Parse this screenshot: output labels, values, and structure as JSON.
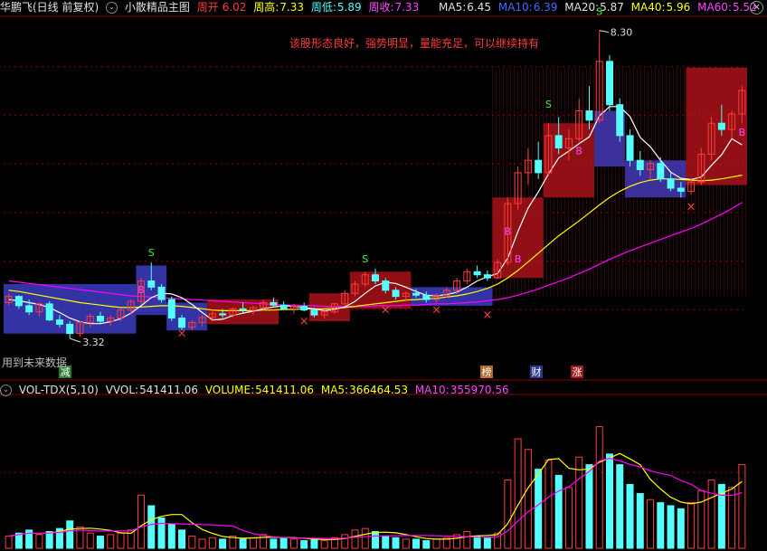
{
  "header": {
    "stock_name": "华鹏飞(日线 前复权)",
    "formula": "小散精品主图",
    "week_open_label": "周开",
    "week_open": "6.02",
    "week_high_label": "周高:",
    "week_high": "7.33",
    "week_low_label": "周低:",
    "week_low": "5.89",
    "week_close_label": "周收:",
    "week_close": "7.33",
    "ma5_label": "MA5:",
    "ma5": "6.45",
    "ma10_label": "MA10:",
    "ma10": "6.39",
    "ma20_label": "MA20:",
    "ma20": "5.87",
    "ma40_label": "MA40:",
    "ma40": "5.96",
    "ma60_label": "MA60:",
    "ma60": "5.52"
  },
  "annotation": "该股形态良好，强势明显，量能充足，可以继续持有",
  "high_label": "8.30",
  "low_label": "3.32",
  "future_note": "用到未来数据",
  "markers": {
    "jian": "减",
    "bang": "榜",
    "cai": "财",
    "zhang": "涨",
    "buy": "B",
    "sell": "S",
    "cross": "×"
  },
  "vol_header": {
    "indicator": "VOL-TDX(5,10)",
    "vvol_label": "VVOL:",
    "vvol": "541411.06",
    "volume_label": "VOLUME:",
    "volume": "541411.06",
    "ma5_label": "MA5:",
    "ma5": "366464.53",
    "ma10_label": "MA10:",
    "ma10": "355970.56"
  },
  "colors": {
    "up": "#ff3c3c",
    "down": "#54ffff",
    "ma5": "#ffffff",
    "ma10": "#ffff00",
    "ma20": "#ff00ff",
    "ma_blue": "#4040ff",
    "box_up": "#c0141c",
    "box_down": "#4444dd",
    "annotation": "#ff3c3c",
    "label_ma5": "#e0e0e0",
    "label_ma10": "#3c6cff",
    "label_ma20": "#e0e0e0",
    "label_ma40": "#ffff00",
    "label_ma60": "#ff44ff"
  },
  "chart_data": {
    "type": "candlestick",
    "y_price_range": [
      3.0,
      8.5
    ],
    "candles": [
      [
        3.9,
        4.05,
        3.85,
        4.0
      ],
      [
        4.0,
        4.02,
        3.8,
        3.85
      ],
      [
        3.85,
        3.95,
        3.7,
        3.75
      ],
      [
        3.75,
        3.9,
        3.68,
        3.88
      ],
      [
        3.88,
        3.92,
        3.6,
        3.62
      ],
      [
        3.62,
        3.7,
        3.5,
        3.55
      ],
      [
        3.55,
        3.6,
        3.32,
        3.4
      ],
      [
        3.4,
        3.6,
        3.35,
        3.58
      ],
      [
        3.58,
        3.72,
        3.5,
        3.68
      ],
      [
        3.68,
        3.75,
        3.55,
        3.6
      ],
      [
        3.6,
        3.7,
        3.52,
        3.65
      ],
      [
        3.65,
        3.8,
        3.6,
        3.78
      ],
      [
        3.78,
        3.95,
        3.7,
        3.92
      ],
      [
        3.92,
        4.3,
        3.88,
        4.25
      ],
      [
        4.25,
        4.55,
        4.1,
        4.15
      ],
      [
        4.15,
        4.2,
        3.9,
        3.95
      ],
      [
        3.95,
        4.0,
        3.6,
        3.65
      ],
      [
        3.65,
        3.7,
        3.45,
        3.5
      ],
      [
        3.5,
        3.62,
        3.45,
        3.58
      ],
      [
        3.58,
        3.7,
        3.52,
        3.66
      ],
      [
        3.66,
        3.78,
        3.6,
        3.72
      ],
      [
        3.72,
        3.8,
        3.65,
        3.7
      ],
      [
        3.7,
        3.82,
        3.66,
        3.8
      ],
      [
        3.8,
        3.9,
        3.74,
        3.78
      ],
      [
        3.78,
        3.85,
        3.7,
        3.82
      ],
      [
        3.82,
        3.95,
        3.78,
        3.9
      ],
      [
        3.9,
        3.98,
        3.82,
        3.86
      ],
      [
        3.86,
        3.92,
        3.78,
        3.8
      ],
      [
        3.8,
        3.88,
        3.72,
        3.84
      ],
      [
        3.84,
        3.9,
        3.76,
        3.78
      ],
      [
        3.78,
        3.82,
        3.66,
        3.7
      ],
      [
        3.7,
        3.78,
        3.64,
        3.75
      ],
      [
        3.75,
        3.9,
        3.72,
        3.88
      ],
      [
        3.88,
        4.1,
        3.85,
        4.05
      ],
      [
        4.05,
        4.25,
        4.0,
        4.2
      ],
      [
        4.2,
        4.4,
        4.15,
        4.35
      ],
      [
        4.35,
        4.45,
        4.2,
        4.25
      ],
      [
        4.25,
        4.3,
        4.05,
        4.1
      ],
      [
        4.1,
        4.15,
        3.95,
        4.0
      ],
      [
        4.0,
        4.08,
        3.92,
        4.05
      ],
      [
        4.05,
        4.12,
        3.98,
        4.02
      ],
      [
        4.02,
        4.08,
        3.9,
        3.95
      ],
      [
        3.95,
        4.05,
        3.9,
        4.02
      ],
      [
        4.02,
        4.15,
        3.98,
        4.1
      ],
      [
        4.1,
        4.3,
        4.05,
        4.25
      ],
      [
        4.25,
        4.45,
        4.2,
        4.4
      ],
      [
        4.4,
        4.5,
        4.3,
        4.35
      ],
      [
        4.35,
        4.42,
        4.25,
        4.3
      ],
      [
        4.3,
        4.6,
        4.28,
        4.55
      ],
      [
        4.55,
        5.6,
        4.5,
        5.5
      ],
      [
        5.5,
        6.1,
        5.4,
        6.0
      ],
      [
        6.0,
        6.4,
        5.8,
        6.2
      ],
      [
        6.2,
        6.5,
        5.9,
        6.0
      ],
      [
        6.0,
        6.8,
        5.95,
        6.6
      ],
      [
        6.6,
        6.9,
        6.3,
        6.4
      ],
      [
        6.4,
        6.7,
        6.2,
        6.55
      ],
      [
        6.55,
        7.2,
        6.5,
        7.0
      ],
      [
        7.0,
        7.4,
        6.7,
        6.85
      ],
      [
        6.85,
        8.3,
        6.8,
        7.8
      ],
      [
        7.8,
        7.9,
        7.0,
        7.1
      ],
      [
        7.1,
        7.2,
        6.5,
        6.6
      ],
      [
        6.6,
        6.7,
        6.1,
        6.2
      ],
      [
        6.2,
        6.35,
        5.95,
        6.05
      ],
      [
        6.05,
        6.2,
        5.9,
        6.15
      ],
      [
        6.15,
        6.25,
        5.85,
        5.9
      ],
      [
        5.9,
        6.0,
        5.7,
        5.75
      ],
      [
        5.75,
        5.85,
        5.6,
        5.7
      ],
      [
        5.7,
        5.9,
        5.65,
        5.85
      ],
      [
        5.85,
        6.4,
        5.8,
        6.3
      ],
      [
        6.3,
        6.9,
        6.2,
        6.8
      ],
      [
        6.8,
        7.1,
        6.6,
        6.7
      ],
      [
        6.7,
        7.0,
        6.55,
        6.95
      ],
      [
        6.95,
        7.4,
        6.8,
        7.33
      ]
    ],
    "volumes": [
      0.08,
      0.1,
      0.12,
      0.09,
      0.11,
      0.13,
      0.18,
      0.14,
      0.1,
      0.08,
      0.09,
      0.1,
      0.12,
      0.35,
      0.28,
      0.2,
      0.16,
      0.12,
      0.08,
      0.06,
      0.07,
      0.06,
      0.08,
      0.06,
      0.07,
      0.09,
      0.06,
      0.07,
      0.06,
      0.05,
      0.06,
      0.05,
      0.07,
      0.09,
      0.12,
      0.13,
      0.11,
      0.08,
      0.07,
      0.06,
      0.06,
      0.05,
      0.06,
      0.07,
      0.09,
      0.11,
      0.08,
      0.07,
      0.1,
      0.45,
      0.72,
      0.65,
      0.52,
      0.58,
      0.48,
      0.4,
      0.6,
      0.55,
      0.8,
      0.62,
      0.55,
      0.42,
      0.36,
      0.32,
      0.3,
      0.28,
      0.26,
      0.3,
      0.38,
      0.45,
      0.42,
      0.4,
      0.55
    ],
    "vol_range": [
      0,
      1.0
    ],
    "ma5": [
      3.95,
      3.93,
      3.9,
      3.87,
      3.82,
      3.74,
      3.65,
      3.59,
      3.56,
      3.56,
      3.59,
      3.64,
      3.73,
      3.85,
      3.98,
      4.05,
      4.04,
      3.98,
      3.87,
      3.74,
      3.62,
      3.63,
      3.69,
      3.73,
      3.76,
      3.8,
      3.83,
      3.85,
      3.84,
      3.82,
      3.8,
      3.77,
      3.79,
      3.83,
      3.92,
      4.05,
      4.17,
      4.23,
      4.21,
      4.15,
      4.08,
      4.02,
      4.01,
      4.03,
      4.07,
      4.15,
      4.25,
      4.32,
      4.37,
      4.62,
      5.05,
      5.43,
      5.69,
      5.98,
      6.24,
      6.35,
      6.47,
      6.58,
      6.92,
      7.07,
      7.07,
      6.91,
      6.57,
      6.42,
      6.2,
      6.01,
      5.91,
      5.89,
      5.93,
      6.12,
      6.29,
      6.55,
      6.45
    ],
    "ma20": [
      4.1,
      4.08,
      4.05,
      4.02,
      3.99,
      3.96,
      3.93,
      3.9,
      3.88,
      3.86,
      3.84,
      3.82,
      3.82,
      3.83,
      3.84,
      3.85,
      3.85,
      3.84,
      3.82,
      3.8,
      3.78,
      3.77,
      3.77,
      3.77,
      3.77,
      3.78,
      3.78,
      3.79,
      3.79,
      3.8,
      3.8,
      3.8,
      3.81,
      3.82,
      3.84,
      3.86,
      3.88,
      3.9,
      3.92,
      3.94,
      3.95,
      3.96,
      3.97,
      3.99,
      4.01,
      4.04,
      4.08,
      4.13,
      4.2,
      4.3,
      4.42,
      4.56,
      4.7,
      4.84,
      4.98,
      5.1,
      5.22,
      5.35,
      5.48,
      5.6,
      5.7,
      5.78,
      5.84,
      5.88,
      5.9,
      5.9,
      5.89,
      5.88,
      5.87,
      5.88,
      5.9,
      5.93,
      5.96
    ],
    "ma60": [
      4.25,
      4.23,
      4.21,
      4.19,
      4.17,
      4.15,
      4.13,
      4.11,
      4.09,
      4.07,
      4.05,
      4.03,
      4.01,
      4.0,
      3.99,
      3.98,
      3.97,
      3.96,
      3.95,
      3.94,
      3.93,
      3.92,
      3.91,
      3.9,
      3.89,
      3.88,
      3.87,
      3.86,
      3.86,
      3.85,
      3.85,
      3.84,
      3.84,
      3.84,
      3.84,
      3.84,
      3.85,
      3.85,
      3.85,
      3.86,
      3.86,
      3.87,
      3.88,
      3.88,
      3.89,
      3.9,
      3.91,
      3.93,
      3.95,
      3.98,
      4.02,
      4.07,
      4.12,
      4.18,
      4.24,
      4.3,
      4.37,
      4.44,
      4.52,
      4.6,
      4.67,
      4.74,
      4.8,
      4.86,
      4.92,
      4.98,
      5.04,
      5.1,
      5.17,
      5.25,
      5.33,
      5.42,
      5.52
    ]
  }
}
